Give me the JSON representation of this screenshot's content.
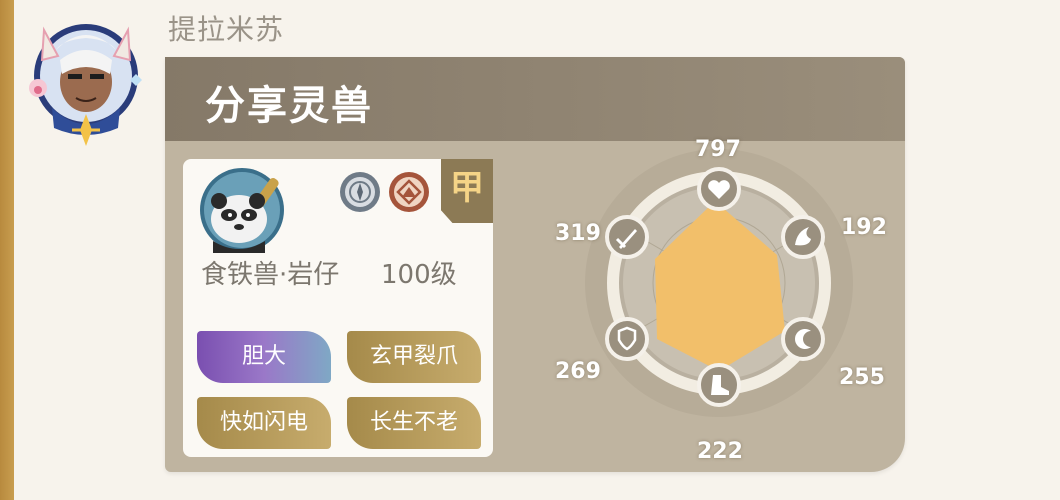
{
  "sender": {
    "name": "提拉米苏",
    "avatar_icon": "character-avatar-icon"
  },
  "card": {
    "title": "分享灵兽",
    "pet": {
      "name": "食铁兽·岩仔",
      "level": "100级",
      "rank": "甲",
      "portrait_icon": "panda-portrait-icon",
      "element_icons": [
        "compass-element-icon",
        "mountain-element-icon"
      ]
    },
    "traits": [
      "胆大",
      "玄甲裂爪",
      "快如闪电",
      "长生不老"
    ],
    "stats": {
      "top": {
        "icon": "heart-icon",
        "value": "797"
      },
      "upper_right": {
        "icon": "flame-icon",
        "value": "192"
      },
      "lower_right": {
        "icon": "moon-swirl-icon",
        "value": "255"
      },
      "bottom": {
        "icon": "boot-icon",
        "value": "222"
      },
      "lower_left": {
        "icon": "shield-icon",
        "value": "269"
      },
      "upper_left": {
        "icon": "sword-icon",
        "value": "319"
      }
    },
    "radar_fill_color": "#f2bf6a"
  }
}
